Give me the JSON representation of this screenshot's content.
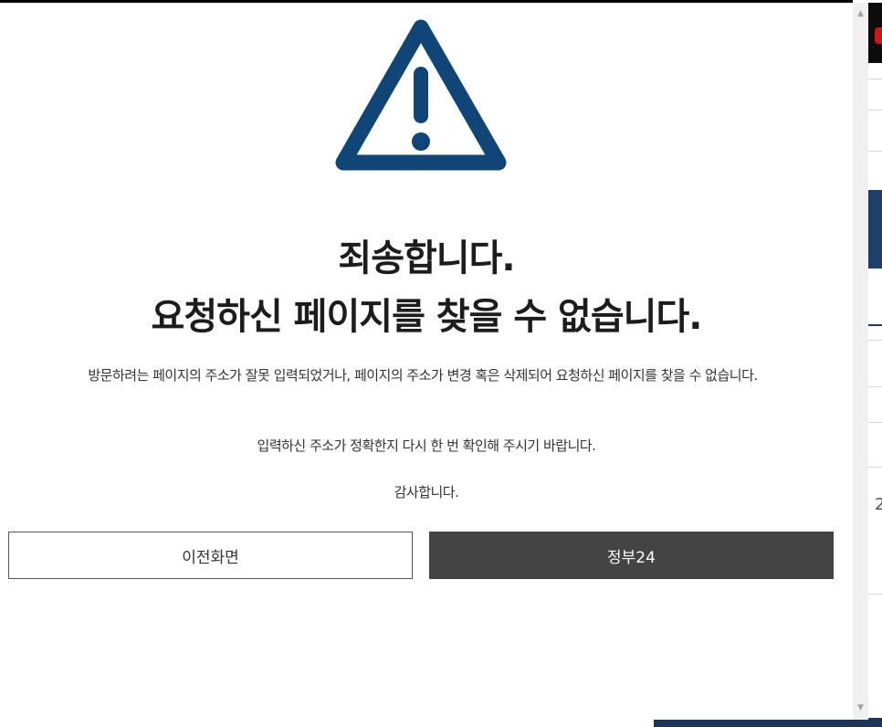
{
  "dialog": {
    "icon": "warning-triangle-icon",
    "icon_color": "#0f4577",
    "title_line1": "죄송합니다.",
    "title_line2": "요청하신 페이지를 찾을 수 없습니다.",
    "message": "방문하려는 페이지의 주소가 잘못 입력되었거나, 페이지의 주소가 변경 혹은 삭제되어 요청하신 페이지를 찾을 수 없습니다.",
    "message2": "입력하신 주소가 정확한지 다시 한 번 확인해 주시기 바랍니다.",
    "message3": "감사합니다.",
    "buttons": {
      "prev_label": "이전화면",
      "gov_label": "정부24",
      "gov_color": "#444444"
    }
  },
  "background": {
    "digit": "2"
  }
}
